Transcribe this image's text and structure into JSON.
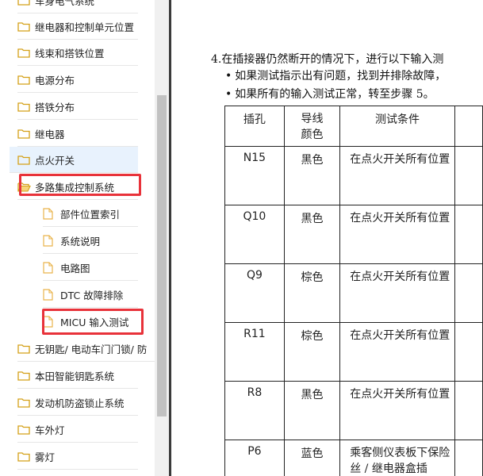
{
  "sidebar": {
    "items": [
      {
        "label": "车身电气系统",
        "type": "folder"
      },
      {
        "label": "继电器和控制单元位置",
        "type": "folder"
      },
      {
        "label": "线束和搭铁位置",
        "type": "folder"
      },
      {
        "label": "电源分布",
        "type": "folder"
      },
      {
        "label": "搭铁分布",
        "type": "folder"
      },
      {
        "label": "继电器",
        "type": "folder"
      },
      {
        "label": "点火开关",
        "type": "folder"
      },
      {
        "label": "多路集成控制系统",
        "type": "folder-open"
      },
      {
        "label": "部件位置索引",
        "type": "document"
      },
      {
        "label": "系统说明",
        "type": "document"
      },
      {
        "label": "电路图",
        "type": "document"
      },
      {
        "label": "DTC 故障排除",
        "type": "document"
      },
      {
        "label": "MICU 输入测试",
        "type": "document"
      },
      {
        "label": "无钥匙/ 电动车门门锁/ 防",
        "type": "folder"
      },
      {
        "label": "本田智能钥匙系统",
        "type": "folder"
      },
      {
        "label": "发动机防盗锁止系统",
        "type": "folder"
      },
      {
        "label": "车外灯",
        "type": "folder"
      },
      {
        "label": "雾灯",
        "type": "folder"
      }
    ]
  },
  "document": {
    "step": "4.在插接器仍然断开的情况下，进行以下输入测",
    "bullets": [
      "如果测试指示出有问题，找到并排除故障，",
      "如果所有的输入测试正常，转至步骤 5。"
    ],
    "table": {
      "headers": [
        "插孔",
        "导线\n颜色",
        "测试条件"
      ],
      "rows": [
        {
          "pin": "N15",
          "color": "黑色",
          "condition": "在点火开关所有位置"
        },
        {
          "pin": "Q10",
          "color": "黑色",
          "condition": "在点火开关所有位置"
        },
        {
          "pin": "Q9",
          "color": "棕色",
          "condition": "在点火开关所有位置"
        },
        {
          "pin": "R11",
          "color": "棕色",
          "condition": "在点火开关所有位置"
        },
        {
          "pin": "R8",
          "color": "黑色",
          "condition": "在点火开关所有位置"
        },
        {
          "pin": "P6",
          "color": "蓝色",
          "condition": "乘客侧仪表板下保险丝 / 继电器盒插"
        }
      ]
    }
  },
  "colors": {
    "highlight": "#e8323a",
    "folder_icon": "#d4a017",
    "doc_icon": "#e9b44c",
    "selected_bg": "#e8f2fd"
  }
}
